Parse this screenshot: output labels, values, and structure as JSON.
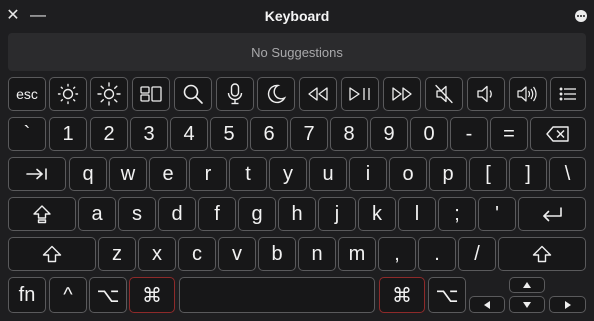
{
  "window": {
    "title": "Keyboard",
    "close_glyph": "✕",
    "minimize_glyph": "—"
  },
  "suggestions": {
    "text": "No Suggestions"
  },
  "function_row": [
    {
      "name": "esc-key",
      "label": "esc"
    },
    {
      "name": "brightness-down-key",
      "icon": "brightness-low-icon"
    },
    {
      "name": "brightness-up-key",
      "icon": "brightness-high-icon"
    },
    {
      "name": "mission-control-key",
      "icon": "mission-control-icon"
    },
    {
      "name": "search-key",
      "icon": "search-icon"
    },
    {
      "name": "dictation-key",
      "icon": "microphone-icon"
    },
    {
      "name": "do-not-disturb-key",
      "icon": "moon-icon"
    },
    {
      "name": "rewind-key",
      "icon": "rewind-icon"
    },
    {
      "name": "play-pause-key",
      "icon": "play-pause-icon"
    },
    {
      "name": "fast-forward-key",
      "icon": "fast-forward-icon"
    },
    {
      "name": "mute-key",
      "icon": "mute-icon"
    },
    {
      "name": "volume-down-key",
      "icon": "volume-down-icon"
    },
    {
      "name": "volume-up-key",
      "icon": "volume-up-icon"
    },
    {
      "name": "menu-key",
      "icon": "list-icon"
    }
  ],
  "number_row": [
    "`",
    "1",
    "2",
    "3",
    "4",
    "5",
    "6",
    "7",
    "8",
    "9",
    "0",
    "-",
    "="
  ],
  "top_row": [
    "q",
    "w",
    "e",
    "r",
    "t",
    "y",
    "u",
    "i",
    "o",
    "p",
    "[",
    "]",
    "\\"
  ],
  "home_row": [
    "a",
    "s",
    "d",
    "f",
    "g",
    "h",
    "j",
    "k",
    "l",
    ";",
    "'"
  ],
  "bottom_row": [
    "z",
    "x",
    "c",
    "v",
    "b",
    "n",
    "m",
    ",",
    ".",
    "/"
  ],
  "modifiers": {
    "fn": "fn",
    "control": "^",
    "option_left": "⌥",
    "command_left": "⌘",
    "command_right": "⌘",
    "option_right": "⌥"
  },
  "colors": {
    "background": "#1e1e20",
    "key_fill": "#171718",
    "key_border": "#5a5a5c",
    "highlight_border": "#8e2a2a",
    "suggestion_bar": "#2b2b2d"
  }
}
